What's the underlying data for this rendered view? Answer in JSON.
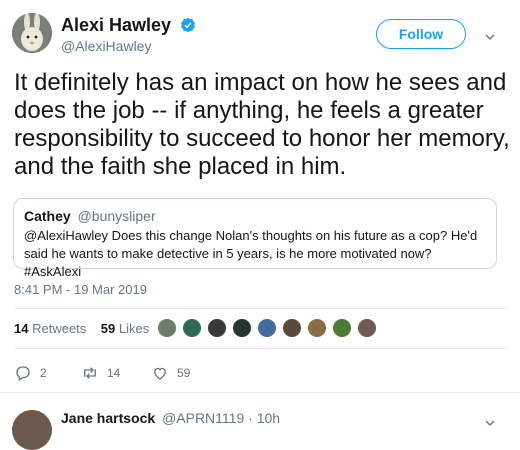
{
  "author": {
    "name": "Alexi Hawley",
    "handle": "@AlexiHawley"
  },
  "follow_label": "Follow",
  "tweet_text": "It definitely has an impact on how he sees and does the job -- if anything, he feels a greater responsibility to succeed to honor her memory, and the faith she placed in him.",
  "quote": {
    "name": "Cathey",
    "handle": "@bunysliper",
    "text": "@AlexiHawley Does this change Nolan's thoughts on his future as a cop? He'd said he wants to make detective in 5 years, is he more motivated now? #AskAlexi"
  },
  "timestamp": "8:41 PM - 19 Mar 2019",
  "stats": {
    "retweets_count": "14",
    "retweets_label": "Retweets",
    "likes_count": "59",
    "likes_label": "Likes"
  },
  "likers": [
    "#6b7d6a",
    "#2f6a55",
    "#3a3a3a",
    "#27352f",
    "#456b9a",
    "#5a4a3a",
    "#8c6b4a",
    "#4f7a3a",
    "#6e5a4e"
  ],
  "actions": {
    "replies": "2",
    "retweets": "14",
    "likes": "59"
  },
  "reply_preview": {
    "name": "Jane hartsock",
    "handle": "@APRN1119",
    "time": "10h"
  },
  "colors": {
    "accent": "#1da1f2",
    "muted": "#657786"
  }
}
